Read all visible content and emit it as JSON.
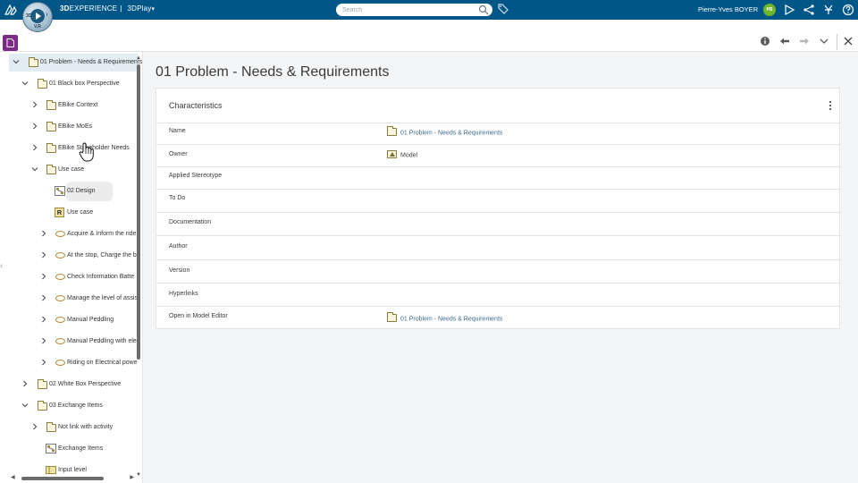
{
  "topbar": {
    "brand_bold": "3D",
    "brand_rest": "EXPERIENCE",
    "separator": "|",
    "app_name": "3DPlay",
    "app_caret": "▾",
    "compass_3d": "3D",
    "compass_vr": "V,R",
    "compass_i": "i",
    "search_placeholder": "Search",
    "user_name": "Pierre-Yves BOYER",
    "avatar_initials": "PB",
    "bar_color": "#005686",
    "avatar_color": "#6fb52c"
  },
  "tree": {
    "items": [
      {
        "label": "01 Problem - Needs & Requirements",
        "icon": "folder-icon",
        "expanded": true
      },
      {
        "label": "01 Black box Perspective",
        "icon": "folder-icon",
        "expanded": true
      },
      {
        "label": "EBike Context",
        "icon": "folder-icon",
        "expanded": false
      },
      {
        "label": "EBike MoEs",
        "icon": "folder-icon",
        "expanded": false
      },
      {
        "label": "EBike Stakeholder Needs",
        "icon": "folder-icon",
        "expanded": false
      },
      {
        "label": "Use case",
        "icon": "folder-icon",
        "expanded": true
      },
      {
        "label": "02 Design",
        "icon": "diagram-icon"
      },
      {
        "label": "Use case",
        "icon": "requirement-icon",
        "badge": "R"
      },
      {
        "label": "Acquire & Inform the ride",
        "icon": "usecase-icon",
        "expanded": false
      },
      {
        "label": "At the stop, Charge the b",
        "icon": "usecase-icon",
        "expanded": false
      },
      {
        "label": "Check Information Batte",
        "icon": "usecase-icon",
        "expanded": false
      },
      {
        "label": "Manage the level of assis",
        "icon": "usecase-icon",
        "expanded": false
      },
      {
        "label": "Manual Peddling",
        "icon": "usecase-icon",
        "expanded": false
      },
      {
        "label": "Manual Peddling with ele",
        "icon": "usecase-icon",
        "expanded": false
      },
      {
        "label": "Riding on Electrical powe",
        "icon": "usecase-icon",
        "expanded": false
      },
      {
        "label": "02 White Box Perspective",
        "icon": "folder-icon",
        "expanded": false
      },
      {
        "label": "03 Exchange Items",
        "icon": "folder-icon",
        "expanded": true
      },
      {
        "label": "Not link with activity",
        "icon": "folder-icon",
        "expanded": false
      },
      {
        "label": "Exchange Items",
        "icon": "diagram-icon"
      },
      {
        "label": "Input level",
        "icon": "block-icon"
      }
    ]
  },
  "main": {
    "title": "01 Problem - Needs & Requirements",
    "card_title": "Characteristics",
    "properties": [
      {
        "key": "Name",
        "value": "01 Problem - Needs & Requirements",
        "value_icon": "folder-icon",
        "link": true
      },
      {
        "key": "Owner",
        "value": "Model",
        "value_icon": "model-icon",
        "link": false
      },
      {
        "key": "Applied Stereotype",
        "value": ""
      },
      {
        "key": "To Do",
        "value": ""
      },
      {
        "key": "Documentation",
        "value": ""
      },
      {
        "key": "Author",
        "value": ""
      },
      {
        "key": "Version",
        "value": ""
      },
      {
        "key": "Hyperlinks",
        "value": ""
      },
      {
        "key": "Open in Model Editor",
        "value": "01 Problem - Needs & Requirements",
        "value_icon": "folder-icon",
        "link": true
      }
    ]
  }
}
